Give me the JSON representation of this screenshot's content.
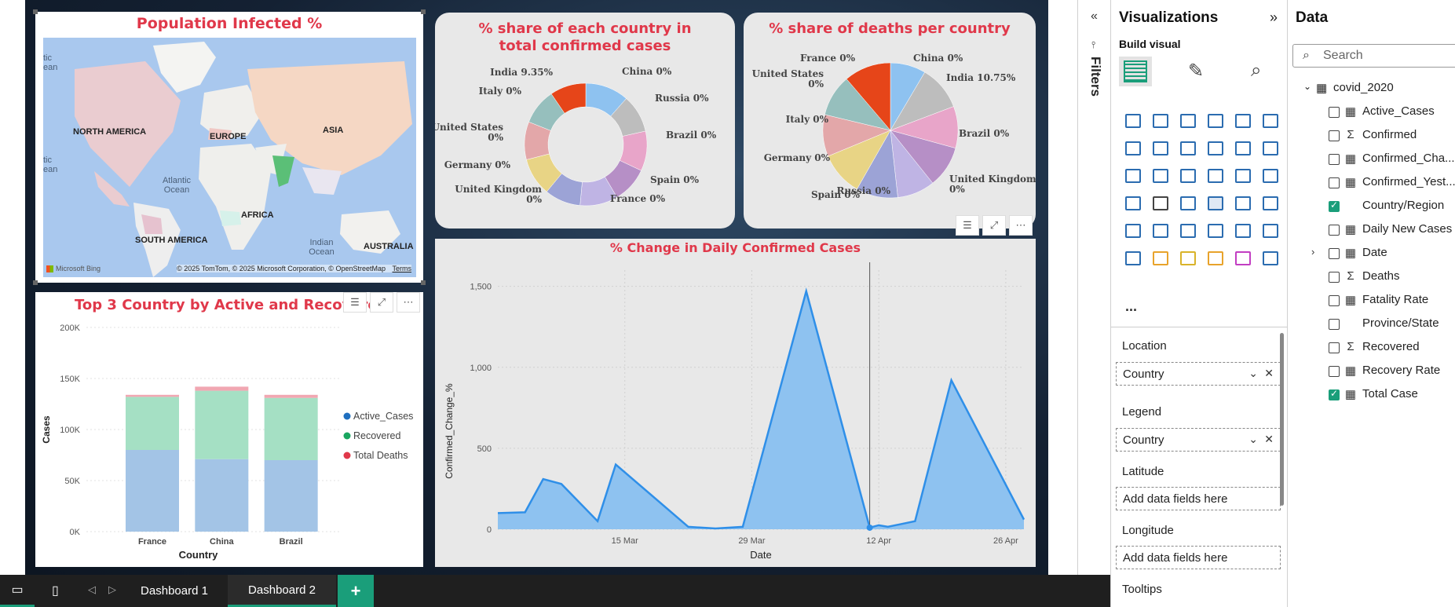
{
  "map": {
    "title": "Population Infected %",
    "continents": [
      "NORTH AMERICA",
      "EUROPE",
      "ASIA",
      "AFRICA",
      "SOUTH AMERICA",
      "AUSTRALIA"
    ],
    "oceans": [
      "Atlantic Ocean",
      "Indian Ocean"
    ],
    "edge_text": [
      "tic",
      "ean",
      "tic",
      "ean"
    ],
    "attribution": "© 2025 TomTom, © 2025 Microsoft Corporation, © OpenStreetMap",
    "terms": "Terms",
    "bing": "Microsoft Bing"
  },
  "donut": {
    "title": "% share of each country in total confirmed cases",
    "labels": [
      "China 0%",
      "Russia 0%",
      "Brazil 0%",
      "Spain 0%",
      "France 0%",
      "United Kingdom 0%",
      "Germany 0%",
      "United States 0%",
      "Italy 0%",
      "India 9.35%"
    ]
  },
  "pie": {
    "title": "% share of deaths per country",
    "labels": [
      "China 0%",
      "India 10.75%",
      "Brazil 0%",
      "United Kingdom 0%",
      "Russia 0%",
      "Spain 0%",
      "Germany 0%",
      "Italy 0%",
      "United States 0%",
      "France 0%"
    ]
  },
  "colors": {
    "accent_title": "#e0384a",
    "teal": "#1a9e7a",
    "area_fill": "#8ec2f0",
    "area_line": "#2f8fe8"
  },
  "chart_data": [
    {
      "type": "bar",
      "title": "Top 3 Country by Active and Recovered",
      "xlabel": "Country",
      "ylabel": "Cases",
      "categories": [
        "France",
        "China",
        "Brazil"
      ],
      "series": [
        {
          "name": "Active_Cases",
          "values": [
            80000,
            71000,
            70000
          ],
          "color": "#a3c4e6"
        },
        {
          "name": "Recovered",
          "values": [
            52000,
            67000,
            61000
          ],
          "color": "#a5e0c4"
        },
        {
          "name": "Total Deaths",
          "values": [
            2000,
            4000,
            3000
          ],
          "color": "#f1a7b2"
        }
      ],
      "ylim": [
        0,
        200000
      ],
      "yticks": [
        "0K",
        "50K",
        "100K",
        "150K",
        "200K"
      ],
      "legend": "right"
    },
    {
      "type": "area",
      "title": "% Change in Daily Confirmed Cases",
      "xlabel": "Date",
      "ylabel": "Confirmed_Change_%",
      "x": [
        "2020-03-01",
        "2020-03-04",
        "2020-03-06",
        "2020-03-08",
        "2020-03-12",
        "2020-03-14",
        "2020-03-22",
        "2020-03-25",
        "2020-03-28",
        "2020-04-04",
        "2020-04-11",
        "2020-04-12",
        "2020-04-13",
        "2020-04-16",
        "2020-04-20",
        "2020-04-28"
      ],
      "y": [
        100,
        105,
        310,
        280,
        50,
        400,
        15,
        5,
        15,
        1470,
        10,
        25,
        15,
        50,
        920,
        60
      ],
      "xticks": [
        "15 Mar",
        "29 Mar",
        "12 Apr",
        "26 Apr"
      ],
      "yticks": [
        "0",
        "500",
        "1,000",
        "1,500"
      ],
      "ylim": [
        0,
        1600
      ]
    }
  ],
  "filters": {
    "label": "Filters"
  },
  "viz_pane": {
    "title": "Visualizations",
    "build_visual": "Build visual",
    "sections": {
      "location": "Location",
      "legend": "Legend",
      "latitude": "Latitude",
      "longitude": "Longitude",
      "tooltips": "Tooltips"
    },
    "location_field": "Country",
    "legend_field": "Country",
    "placeholder": "Add data fields here",
    "more": "..."
  },
  "data_pane": {
    "title": "Data",
    "search_placeholder": "Search",
    "table": "covid_2020",
    "fields": [
      {
        "name": "Active_Cases",
        "icon": "calc",
        "checked": false
      },
      {
        "name": "Confirmed",
        "icon": "sigma",
        "checked": false
      },
      {
        "name": "Confirmed_Cha...",
        "icon": "calc",
        "checked": false
      },
      {
        "name": "Confirmed_Yest...",
        "icon": "calc",
        "checked": false
      },
      {
        "name": "Country/Region",
        "icon": "",
        "checked": true
      },
      {
        "name": "Daily New Cases",
        "icon": "calc",
        "checked": false
      },
      {
        "name": "Date",
        "icon": "calc",
        "checked": false
      },
      {
        "name": "Deaths",
        "icon": "sigma",
        "checked": false
      },
      {
        "name": "Fatality Rate",
        "icon": "calc",
        "checked": false
      },
      {
        "name": "Province/State",
        "icon": "",
        "checked": false
      },
      {
        "name": "Recovered",
        "icon": "sigma",
        "checked": false
      },
      {
        "name": "Recovery Rate",
        "icon": "calc",
        "checked": false
      },
      {
        "name": "Total Case",
        "icon": "calc",
        "checked": true
      }
    ]
  },
  "tabs": {
    "items": [
      "Dashboard 1",
      "Dashboard 2"
    ],
    "active": "Dashboard 2",
    "add": "+"
  }
}
